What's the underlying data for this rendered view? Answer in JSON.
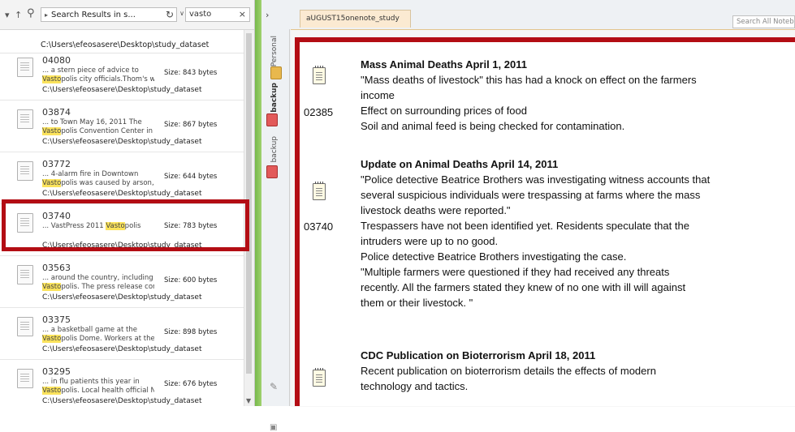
{
  "explorer": {
    "address_text": "Search Results in s...",
    "search_query": "vasto",
    "top_path": "C:\\Users\\efeosasere\\Desktop\\study_dataset",
    "results": [
      {
        "id": "04080",
        "snippet_pre": "... a stern piece of advice to",
        "snippet_hl": "Vasto",
        "snippet_post": "polis city officials.Thom's w...",
        "size": "Size: 843 bytes",
        "path": "C:\\Users\\efeosasere\\Desktop\\study_dataset"
      },
      {
        "id": "03874",
        "snippet_pre": "... to Town May 16, 2011 The",
        "snippet_hl": "Vasto",
        "snippet_post": "polis Convention Center in ...",
        "size": "Size: 867 bytes",
        "path": "C:\\Users\\efeosasere\\Desktop\\study_dataset"
      },
      {
        "id": "03772",
        "snippet_pre": "... 4-alarm fire in Downtown",
        "snippet_hl": "Vasto",
        "snippet_post": "polis was caused by arson, r...",
        "size": "Size: 644 bytes",
        "path": "C:\\Users\\efeosasere\\Desktop\\study_dataset"
      },
      {
        "id": "03740",
        "snippet_pre": "... VastPress 2011",
        "snippet_hl": "Vasto",
        "snippet_post": "polis",
        "size": "Size: 783 bytes",
        "path": "C:\\Users\\efeosasere\\Desktop\\study_dataset"
      },
      {
        "id": "03563",
        "snippet_pre": "... around the country, including",
        "snippet_hl": "Vasto",
        "snippet_post": "polis. The press release conf...",
        "size": "Size: 600 bytes",
        "path": "C:\\Users\\efeosasere\\Desktop\\study_dataset"
      },
      {
        "id": "03375",
        "snippet_pre": "... a basketball game at the",
        "snippet_hl": "Vasto",
        "snippet_post": "polis Dome. Workers at the ...",
        "size": "Size: 898 bytes",
        "path": "C:\\Users\\efeosasere\\Desktop\\study_dataset"
      },
      {
        "id": "03295",
        "snippet_pre": "... in flu patients this year in",
        "snippet_hl": "Vasto",
        "snippet_post": "polis. Local health official N...",
        "size": "Size: 676 bytes",
        "path": "C:\\Users\\efeosasere\\Desktop\\study_dataset"
      }
    ]
  },
  "onenote": {
    "page_tab": "aUGUST15onenote_study",
    "search_placeholder": "Search All Notebooks",
    "sections": [
      "Personal",
      "backup",
      "backup"
    ],
    "notes": [
      {
        "id": "02385",
        "title": "Mass Animal Deaths April 1, 2011",
        "lines": [
          "\"Mass deaths of livestock\" this has had a knock on effect on the farmers",
          "income",
          "Effect on surrounding prices of food",
          "Soil and animal feed is being checked for contamination."
        ]
      },
      {
        "id": "03740",
        "title": "Update on Animal Deaths April 14, 2011",
        "lines": [
          "\"Police detective Beatrice Brothers was investigating witness accounts that",
          "several suspicious individuals were trespassing at farms where the mass",
          "livestock deaths were reported.\"",
          "Trespassers have not been identified yet. Residents speculate that the",
          "intruders were up to no good.",
          "Police detective Beatrice Brothers investigating the case.",
          "\"Multiple farmers were questioned if they had received any threats",
          "recently. All the farmers stated they knew of no one with ill will against",
          "them or their livestock. \""
        ]
      },
      {
        "id": "",
        "title": "CDC Publication on Bioterrorism April 18, 2011",
        "lines": [
          "Recent publication on bioterrorism details the effects of modern",
          "technology and tactics."
        ]
      }
    ]
  },
  "colors": {
    "highlight_frame": "#b30d14",
    "splitter": "#8cc55c",
    "search_hit": "#fbe35c",
    "page_tab": "#fbead2"
  }
}
